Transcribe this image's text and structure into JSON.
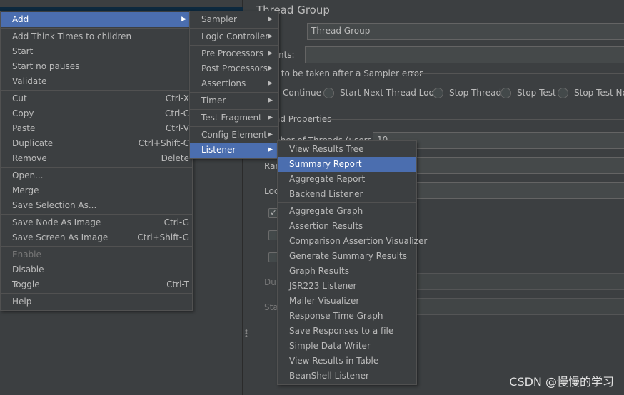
{
  "panel": {
    "title": "Thread Group",
    "name_label": ":",
    "name_value": "Thread Group",
    "comments_label": "nents:",
    "sampler_error_label": "on to be taken after a Sampler error",
    "radios": [
      {
        "label": "Continue",
        "checked": true
      },
      {
        "label": "Start Next Thread Loop"
      },
      {
        "label": "Stop Thread"
      },
      {
        "label": "Stop Test"
      },
      {
        "label": "Stop Test Now"
      }
    ],
    "thread_props_label": "ad Properties",
    "num_threads_label": "nber of Threads (users):",
    "num_threads_value": "10",
    "ramp_label": "Rar",
    "loop_label": "Loc",
    "duration_label": "Du",
    "startup_label": "Sta"
  },
  "context_menu": {
    "items": [
      {
        "label": "Add",
        "selected": true,
        "submenu": true
      },
      {
        "sep": true
      },
      {
        "label": "Add Think Times to children"
      },
      {
        "label": "Start"
      },
      {
        "label": "Start no pauses"
      },
      {
        "label": "Validate"
      },
      {
        "sep": true
      },
      {
        "label": "Cut",
        "shortcut": "Ctrl-X"
      },
      {
        "label": "Copy",
        "shortcut": "Ctrl-C"
      },
      {
        "label": "Paste",
        "shortcut": "Ctrl-V"
      },
      {
        "label": "Duplicate",
        "shortcut": "Ctrl+Shift-C"
      },
      {
        "label": "Remove",
        "shortcut": "Delete"
      },
      {
        "sep": true
      },
      {
        "label": "Open..."
      },
      {
        "label": "Merge"
      },
      {
        "label": "Save Selection As..."
      },
      {
        "sep": true
      },
      {
        "label": "Save Node As Image",
        "shortcut": "Ctrl-G"
      },
      {
        "label": "Save Screen As Image",
        "shortcut": "Ctrl+Shift-G"
      },
      {
        "sep": true
      },
      {
        "label": "Enable",
        "disabled": true
      },
      {
        "label": "Disable"
      },
      {
        "label": "Toggle",
        "shortcut": "Ctrl-T"
      },
      {
        "sep": true
      },
      {
        "label": "Help"
      }
    ]
  },
  "add_submenu": {
    "items": [
      {
        "label": "Sampler",
        "submenu": true
      },
      {
        "sep": true
      },
      {
        "label": "Logic Controller",
        "submenu": true
      },
      {
        "sep": true
      },
      {
        "label": "Pre Processors",
        "submenu": true
      },
      {
        "label": "Post Processors",
        "submenu": true
      },
      {
        "label": "Assertions",
        "submenu": true
      },
      {
        "sep": true
      },
      {
        "label": "Timer",
        "submenu": true
      },
      {
        "sep": true
      },
      {
        "label": "Test Fragment",
        "submenu": true
      },
      {
        "sep": true
      },
      {
        "label": "Config Element",
        "submenu": true
      },
      {
        "label": "Listener",
        "submenu": true,
        "selected": true
      }
    ]
  },
  "listener_submenu": {
    "items": [
      {
        "label": "View Results Tree"
      },
      {
        "label": "Summary Report",
        "selected": true
      },
      {
        "label": "Aggregate Report"
      },
      {
        "label": "Backend Listener"
      },
      {
        "sep": true
      },
      {
        "label": "Aggregate Graph"
      },
      {
        "label": "Assertion Results"
      },
      {
        "label": "Comparison Assertion Visualizer"
      },
      {
        "label": "Generate Summary Results"
      },
      {
        "label": "Graph Results"
      },
      {
        "label": "JSR223 Listener"
      },
      {
        "label": "Mailer Visualizer"
      },
      {
        "label": "Response Time Graph"
      },
      {
        "label": "Save Responses to a file"
      },
      {
        "label": "Simple Data Writer"
      },
      {
        "label": "View Results in Table"
      },
      {
        "label": "BeanShell Listener"
      }
    ]
  },
  "watermark": "CSDN @慢慢的学习",
  "colors": {
    "background": "#3c3f41",
    "highlight": "#4b6eaf",
    "text": "#bbbbbb",
    "border": "#515151"
  }
}
